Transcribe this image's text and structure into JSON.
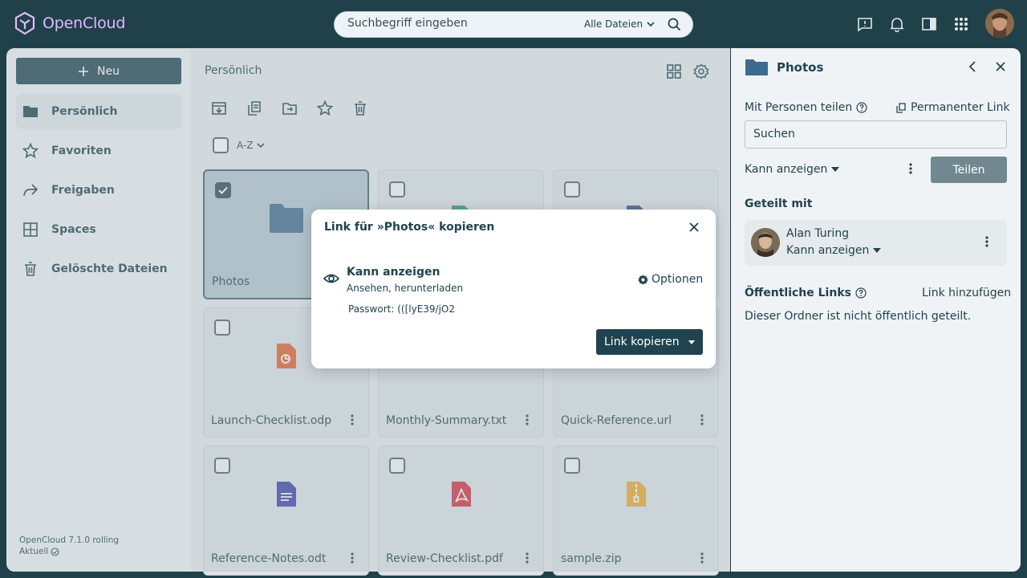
{
  "app": {
    "name": "OpenCloud"
  },
  "search": {
    "placeholder": "Suchbegriff eingeben",
    "scope": "Alle Dateien"
  },
  "sidebar": {
    "new_label": "Neu",
    "items": [
      {
        "label": "Persönlich"
      },
      {
        "label": "Favoriten"
      },
      {
        "label": "Freigaben"
      },
      {
        "label": "Spaces"
      },
      {
        "label": "Gelöschte Dateien"
      }
    ],
    "version": "OpenCloud 7.1.0 rolling",
    "status": "Aktuell"
  },
  "main": {
    "breadcrumb": "Persönlich",
    "sort_label": "A-Z",
    "files": [
      {
        "name": "Photos",
        "type": "folder",
        "selected": true
      },
      {
        "name": "",
        "type": "spreadsheet"
      },
      {
        "name": "",
        "type": "document"
      },
      {
        "name": "Launch-Checklist.odp",
        "type": "presentation"
      },
      {
        "name": "Monthly-Summary.txt",
        "type": "text"
      },
      {
        "name": "Quick-Reference.url",
        "type": "url"
      },
      {
        "name": "Reference-Notes.odt",
        "type": "document"
      },
      {
        "name": "Review-Checklist.pdf",
        "type": "pdf"
      },
      {
        "name": "sample.zip",
        "type": "archive"
      }
    ]
  },
  "panel": {
    "title": "Photos",
    "share_label": "Mit Personen teilen",
    "permanent_link": "Permanenter Link",
    "search_placeholder": "Suchen",
    "role": "Kann anzeigen",
    "share_button": "Teilen",
    "shared_with_label": "Geteilt mit",
    "shared_user": {
      "name": "Alan Turing",
      "role": "Kann anzeigen"
    },
    "public_links_label": "Öffentliche Links",
    "add_link": "Link hinzufügen",
    "not_shared": "Dieser Ordner ist nicht öffentlich geteilt."
  },
  "modal": {
    "title": "Link für »Photos« kopieren",
    "role": "Kann anzeigen",
    "role_desc": "Ansehen, herunterladen",
    "options": "Optionen",
    "password": "Passwort: (([lyE39/jO2",
    "copy_button": "Link kopieren"
  },
  "colors": {
    "primary": "#20434f",
    "brand": "#e2baff",
    "background": "#20414a"
  }
}
